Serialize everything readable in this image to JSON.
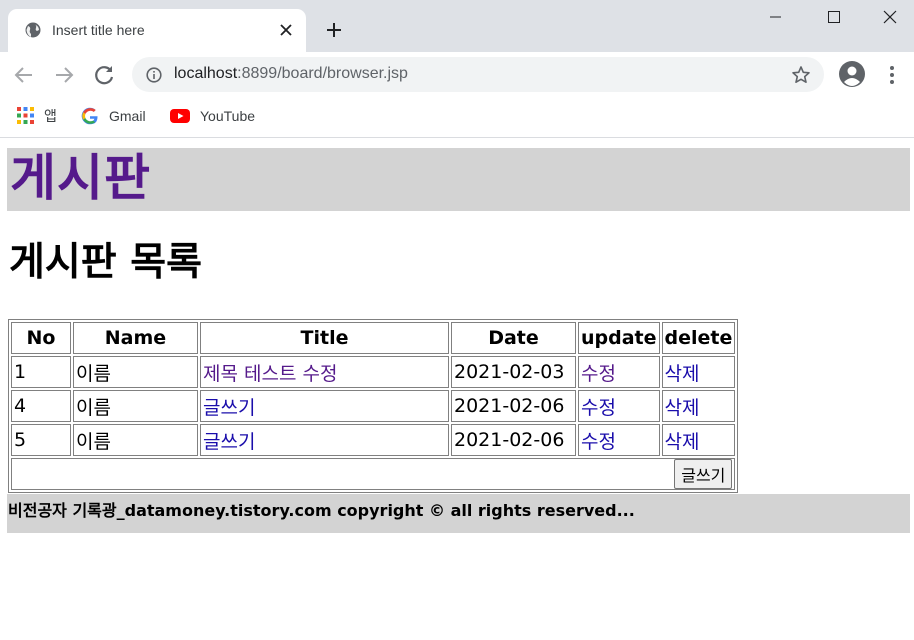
{
  "browser": {
    "tab_title": "Insert title here",
    "url_host": "localhost",
    "url_rest": ":8899/board/browser.jsp",
    "bookmarks": [
      {
        "label": "앱",
        "icon": "apps-icon"
      },
      {
        "label": "Gmail",
        "icon": "google-icon"
      },
      {
        "label": "YouTube",
        "icon": "youtube-icon"
      }
    ]
  },
  "page": {
    "site_title": "게시판",
    "list_title": "게시판 목록",
    "table": {
      "headers": [
        "No",
        "Name",
        "Title",
        "Date",
        "update",
        "delete"
      ],
      "rows": [
        {
          "no": "1",
          "name": "이름",
          "title": "제목 테스트 수정",
          "date": "2021-02-03",
          "update": "수정",
          "delete": "삭제"
        },
        {
          "no": "4",
          "name": "이름",
          "title": "글쓰기",
          "date": "2021-02-06",
          "update": "수정",
          "delete": "삭제"
        },
        {
          "no": "5",
          "name": "이름",
          "title": "글쓰기",
          "date": "2021-02-06",
          "update": "수정",
          "delete": "삭제"
        }
      ],
      "write_button": "글쓰기"
    },
    "footer": "비전공자 기록광_datamoney.tistory.com copyright © all rights reserved..."
  },
  "colors": {
    "visited_link": "#551a8b",
    "link": "#1a0dab",
    "header_bg": "#d3d3d3"
  }
}
